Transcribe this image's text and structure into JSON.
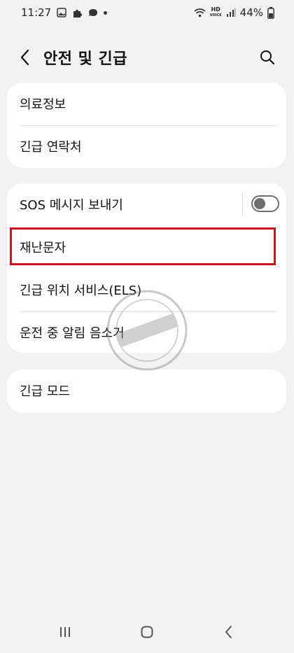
{
  "status_bar": {
    "time": "11:27",
    "hd_label": "HD",
    "hd_sub": "VOICE",
    "battery": "44%",
    "icons": [
      "gallery-icon",
      "puzzle-icon",
      "chat-bubble-icon",
      "dot-icon",
      "wifi-icon",
      "signal-icon",
      "battery-icon"
    ]
  },
  "header": {
    "title": "안전 및 긴급",
    "back_icon": "chevron-left-icon",
    "search_icon": "search-icon"
  },
  "groups": [
    {
      "items": [
        {
          "label": "의료정보"
        },
        {
          "label": "긴급 연락처"
        }
      ]
    },
    {
      "items": [
        {
          "label": "SOS 메시지 보내기",
          "toggle": false
        },
        {
          "label": "재난문자",
          "highlighted": true
        },
        {
          "label": "긴급 위치 서비스(ELS)"
        },
        {
          "label": "운전 중 알림 음소거"
        }
      ]
    },
    {
      "items": [
        {
          "label": "긴급 모드"
        }
      ]
    }
  ],
  "highlight_color": "#c9161e",
  "watermark": {
    "text": "블로그한경닷컴"
  },
  "nav_bar": {
    "icons": [
      "recents-icon",
      "home-icon",
      "back-icon"
    ]
  }
}
